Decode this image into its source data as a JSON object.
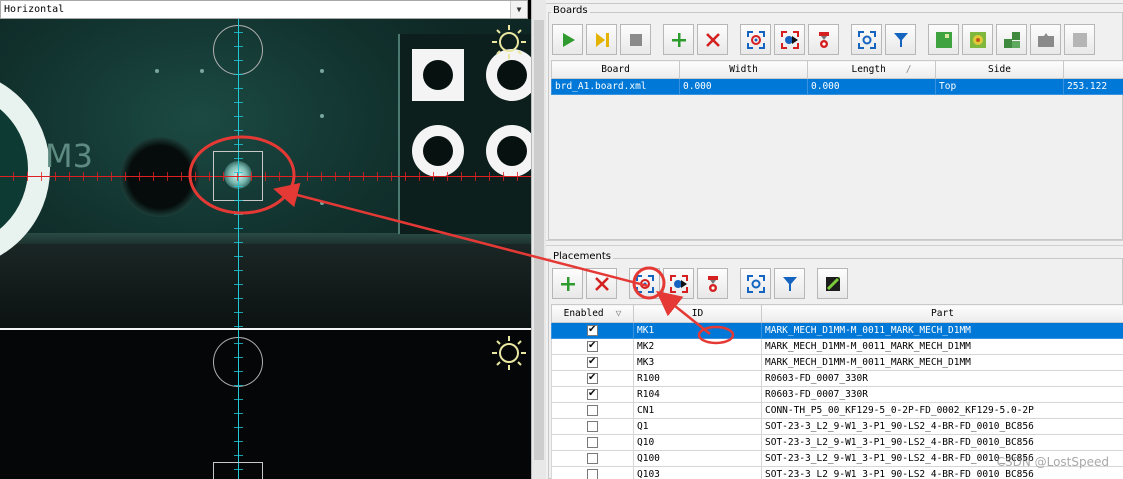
{
  "camera": {
    "direction_value": "Horizontal",
    "silkscreen_text": "M3"
  },
  "boards": {
    "title": "Boards",
    "toolbar_icons": [
      "play-icon",
      "step-icon",
      "stop-icon",
      "add-icon",
      "delete-icon",
      "capture-icon",
      "move-to-icon",
      "pick-icon",
      "center-icon",
      "filter-icon",
      "board-green-icon",
      "board-pad-icon",
      "board-multi-icon",
      "board-gray-icon",
      "board-disabled-icon"
    ],
    "columns": [
      "Board",
      "Width",
      "Length",
      "Side",
      ""
    ],
    "rows": [
      {
        "board": "brd_A1.board.xml",
        "width": "0.000",
        "length": "0.000",
        "side": "Top",
        "extra": "253.122"
      }
    ]
  },
  "placements": {
    "title": "Placements",
    "toolbar_icons": [
      "add-icon",
      "delete-icon",
      "capture-icon",
      "move-to-icon",
      "pick-icon",
      "center-icon",
      "filter-icon",
      "edit-icon"
    ],
    "columns": [
      "Enabled",
      "ID",
      "Part"
    ],
    "rows": [
      {
        "enabled": true,
        "id": "MK1",
        "part": "MARK_MECH_D1MM-M_0011_MARK_MECH_D1MM"
      },
      {
        "enabled": true,
        "id": "MK2",
        "part": "MARK_MECH_D1MM-M_0011_MARK_MECH_D1MM"
      },
      {
        "enabled": true,
        "id": "MK3",
        "part": "MARK_MECH_D1MM-M_0011_MARK_MECH_D1MM"
      },
      {
        "enabled": true,
        "id": "R100",
        "part": "R0603-FD_0007_330R"
      },
      {
        "enabled": true,
        "id": "R104",
        "part": "R0603-FD_0007_330R"
      },
      {
        "enabled": false,
        "id": "CN1",
        "part": "CONN-TH_P5_00_KF129-5_0-2P-FD_0002_KF129-5.0-2P"
      },
      {
        "enabled": false,
        "id": "Q1",
        "part": "SOT-23-3_L2_9-W1_3-P1_90-LS2_4-BR-FD_0010_BC856"
      },
      {
        "enabled": false,
        "id": "Q10",
        "part": "SOT-23-3_L2_9-W1_3-P1_90-LS2_4-BR-FD_0010_BC856"
      },
      {
        "enabled": false,
        "id": "Q100",
        "part": "SOT-23-3_L2_9-W1_3-P1_90-LS2_4-BR-FD_0010_BC856"
      },
      {
        "enabled": false,
        "id": "Q103",
        "part": "SOT-23-3_L2_9-W1_3-P1_90-LS2_4-BR-FD_0010_BC856"
      }
    ]
  },
  "watermark": "CSDN @LostSpeed",
  "colors": {
    "selection": "#0078d7",
    "annotation": "#e53935",
    "crosshair": "#e02020",
    "reticle": "#20c8d8"
  }
}
